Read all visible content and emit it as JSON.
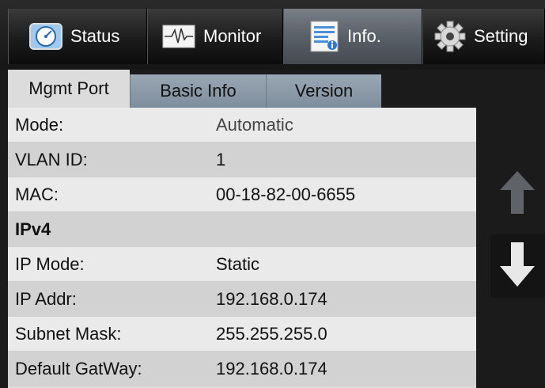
{
  "toolbar": {
    "tabs": [
      {
        "label": "Status",
        "icon": "gauge-icon"
      },
      {
        "label": "Monitor",
        "icon": "waveform-icon"
      },
      {
        "label": "Info.",
        "icon": "document-info-icon"
      },
      {
        "label": "Setting",
        "icon": "gear-icon"
      }
    ],
    "active": "Info."
  },
  "subtabs": [
    {
      "label": "Mgmt Port"
    },
    {
      "label": "Basic Info"
    },
    {
      "label": "Version"
    }
  ],
  "info": {
    "mode": {
      "label": "Mode:",
      "value": "Automatic"
    },
    "vlan": {
      "label": "VLAN ID:",
      "value": "1"
    },
    "mac": {
      "label": "MAC:",
      "value": "00-18-82-00-6655"
    },
    "ipv4_heading": "IPv4",
    "ip_mode": {
      "label": "IP Mode:",
      "value": "Static"
    },
    "ip_addr": {
      "label": "IP Addr:",
      "value": "192.168.0.174"
    },
    "subnet": {
      "label": "Subnet Mask:",
      "value": "255.255.255.0"
    },
    "gateway": {
      "label": "Default GatWay:",
      "value": "192.168.0.174"
    }
  },
  "colors": {
    "accent_tab": "#5a6068",
    "panel_bg": "#dcdcdc",
    "arrow_up": "#5f6266",
    "arrow_down": "#e8e8e8"
  }
}
